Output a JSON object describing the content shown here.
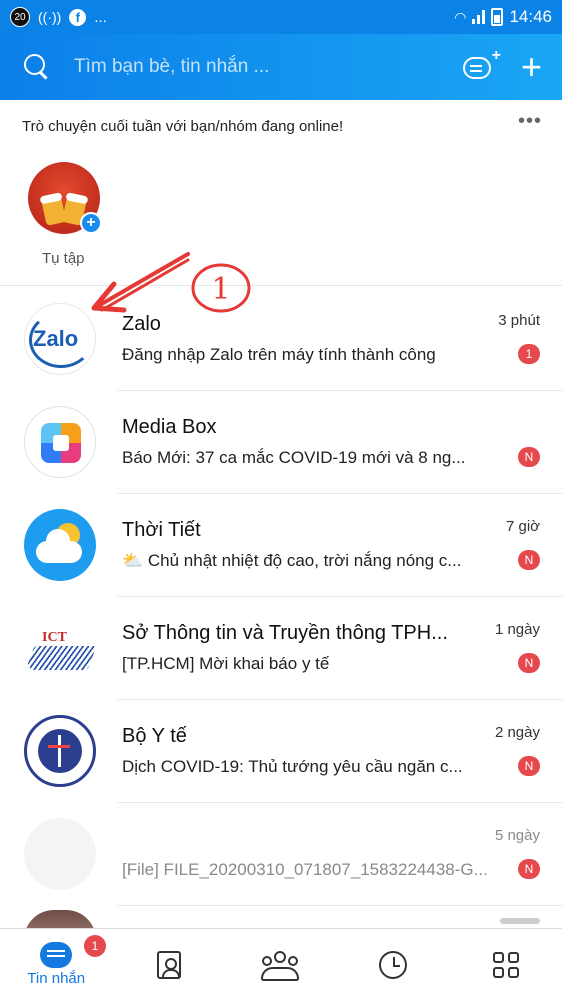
{
  "status_bar": {
    "notif_badge": "20",
    "ellipsis": "...",
    "fb": "f",
    "time": "14:46",
    "icons": [
      "radio-icon",
      "facebook-icon",
      "wifi-icon",
      "signal-icon",
      "battery-icon"
    ]
  },
  "header": {
    "search_placeholder": "Tìm bạn bè, tin nhắn ...",
    "new_chat_icon": "new-message-icon",
    "add_icon": "plus-icon"
  },
  "promo": {
    "title": "Trò chuyện cuối tuần với bạn/nhóm đang online!",
    "more": "•••",
    "group_label": "Tụ tập",
    "add_badge": "+"
  },
  "annotation": {
    "number": "1",
    "color": "#e53935"
  },
  "conversations": [
    {
      "name": "Zalo",
      "time": "3 phút",
      "preview": "Đăng nhập Zalo trên máy tính thành công",
      "badge": "1",
      "avatar_text": "Zalo"
    },
    {
      "name": "Media Box",
      "time": "",
      "preview": "Báo Mới: 37 ca mắc COVID-19 mới và 8 ng...",
      "badge": "N"
    },
    {
      "name": "Thời Tiết",
      "time": "7 giờ",
      "preview": "⛅ Chủ nhật nhiệt độ cao, trời nắng nóng c...",
      "badge": "N"
    },
    {
      "name": "Sở Thông tin và Truyền thông TPH...",
      "time": "1 ngày",
      "preview": "[TP.HCM] Mời khai báo y tế",
      "badge": "N",
      "avatar_text": "ICT"
    },
    {
      "name": "Bộ Y tế",
      "time": "2 ngày",
      "preview": "Dịch COVID-19: Thủ tướng yêu cầu ngăn c...",
      "badge": "N"
    },
    {
      "name": "",
      "time": "5 ngày",
      "preview": "[File] FILE_20200310_071807_1583224438-G...",
      "badge": "N"
    }
  ],
  "bottom_nav": {
    "messages_label": "Tin nhắn",
    "messages_badge": "1"
  },
  "colors": {
    "brand": "#0a82e6",
    "badge": "#e5484d",
    "active_tab": "#1479e0"
  }
}
